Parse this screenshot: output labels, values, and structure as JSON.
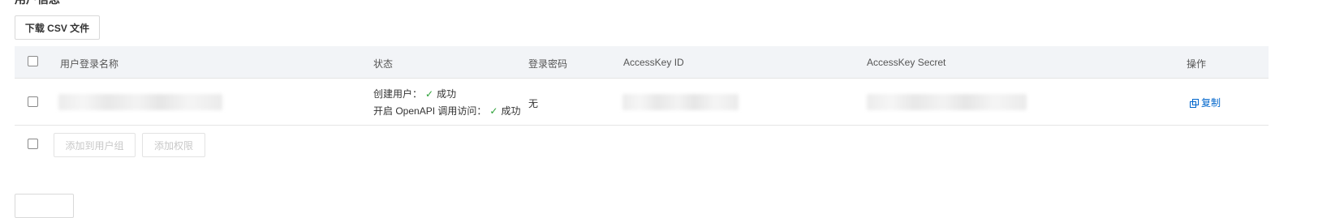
{
  "section": {
    "title": "用户信息"
  },
  "toolbar": {
    "download_label": "下载 CSV 文件"
  },
  "table": {
    "columns": [
      "用户登录名称",
      "状态",
      "登录密码",
      "AccessKey ID",
      "AccessKey Secret",
      "操作"
    ],
    "rows": [
      {
        "status_create_label": "创建用户：",
        "status_create_value": "成功",
        "status_api_label": "开启 OpenAPI 调用访问：",
        "status_api_value": "成功",
        "password": "无",
        "action": "复制"
      }
    ]
  },
  "footer_actions": {
    "add_group": "添加到用户组",
    "add_permission": "添加权限"
  },
  "icons": {
    "check": "check-icon",
    "copy": "copy-icon"
  },
  "colors": {
    "success": "#2aa035",
    "link": "#0066cc",
    "header_bg": "#f2f4f7"
  }
}
